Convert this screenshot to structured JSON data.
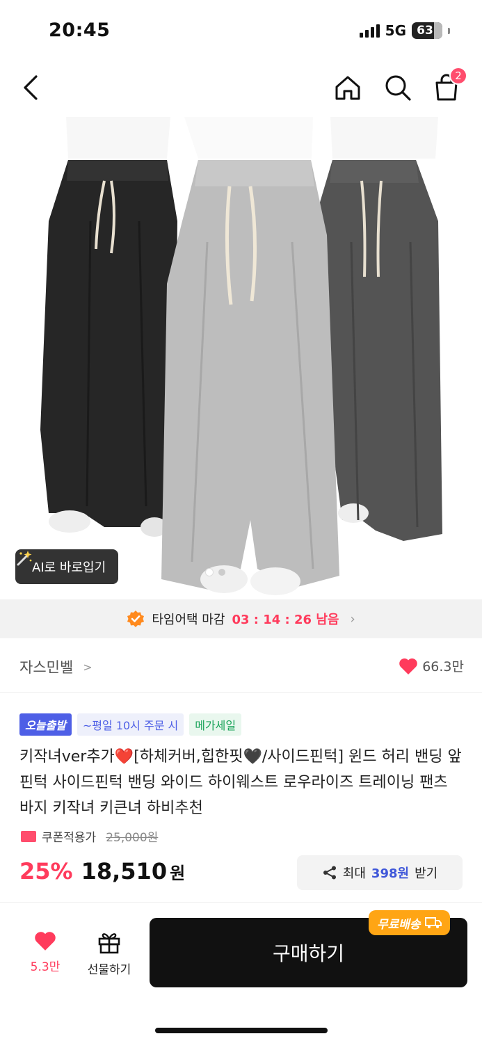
{
  "status_bar": {
    "time": "20:45",
    "network": "5G",
    "battery": "63"
  },
  "nav": {
    "cart_count": "2"
  },
  "hero": {
    "ai_button_label": "AI로 바로입기",
    "slide_count": 2,
    "active_slide": 1
  },
  "timeattack": {
    "label": "타임어택 마감",
    "time": "03 : 14 : 26 남음"
  },
  "brand": {
    "name": "자스민벨",
    "likes": "66.3만"
  },
  "tags": [
    "오늘출발",
    "~평일 10시 주문 시",
    "메가세일"
  ],
  "product": {
    "title": "키작녀ver추가❤️[하체커버,힙한핏🖤/사이드핀턱] 윈드 허리 밴딩 앞핀턱 사이드핀턱 밴딩 와이드 하이웨스트 로우라이즈 트레이닝 팬츠 바지 키작녀 키큰녀 하비추천",
    "coupon_label": "쿠폰적용가",
    "original_price": "25,000원",
    "discount": "25%",
    "price": "18,510",
    "currency": "원"
  },
  "share": {
    "prefix": "최대",
    "amount": "398원",
    "suffix": "받기"
  },
  "bottom_bar": {
    "like_count": "5.3만",
    "gift_label": "선물하기",
    "buy_label": "구매하기",
    "free_shipping": "무료배송"
  },
  "colors": {
    "accent_red": "#ff3b5c",
    "brand_blue": "#4e5fe6",
    "shipping_orange": "#ffa514"
  }
}
